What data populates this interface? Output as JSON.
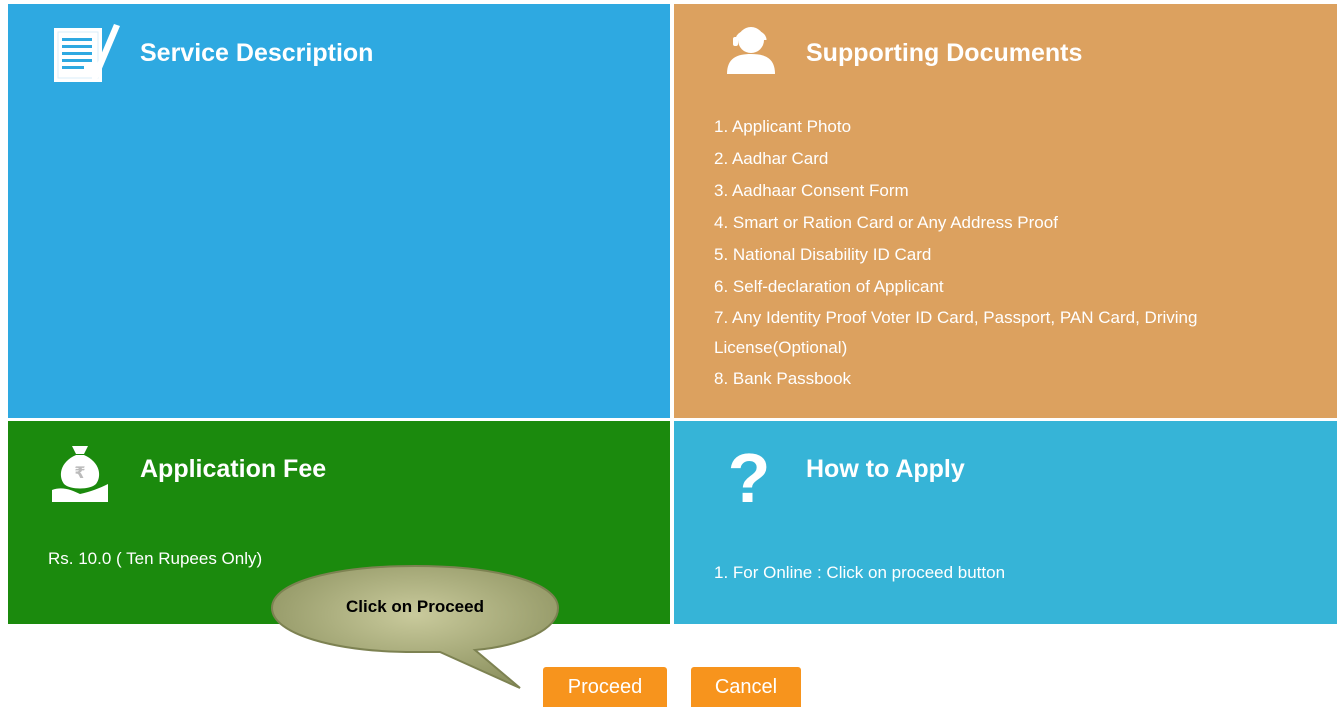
{
  "panels": {
    "description": {
      "title": "Service Description",
      "icon": "document-icon",
      "color": "#2ea9e1"
    },
    "documents": {
      "title": "Supporting Documents",
      "icon": "person-icon",
      "color": "#dca15f",
      "items": [
        "1. Applicant Photo",
        "2. Aadhar Card",
        "3. Aadhaar Consent Form",
        "4. Smart or Ration Card or Any Address Proof",
        "5. National Disability ID Card",
        "6. Self-declaration of Applicant",
        "7. Any Identity Proof Voter ID Card, Passport, PAN Card, Driving License(Optional)",
        "8. Bank Passbook"
      ]
    },
    "fee": {
      "title": "Application Fee",
      "icon": "money-bag-icon",
      "color": "#1b8a0d",
      "text": "Rs. 10.0 ( Ten Rupees Only)"
    },
    "how": {
      "title": "How to Apply",
      "icon": "question-mark-icon",
      "color": "#36b4d7",
      "text": "1. For Online : Click on proceed button"
    }
  },
  "callout": {
    "text": "Click on Proceed"
  },
  "buttons": {
    "proceed": "Proceed",
    "cancel": "Cancel",
    "color": "#f7941d"
  }
}
